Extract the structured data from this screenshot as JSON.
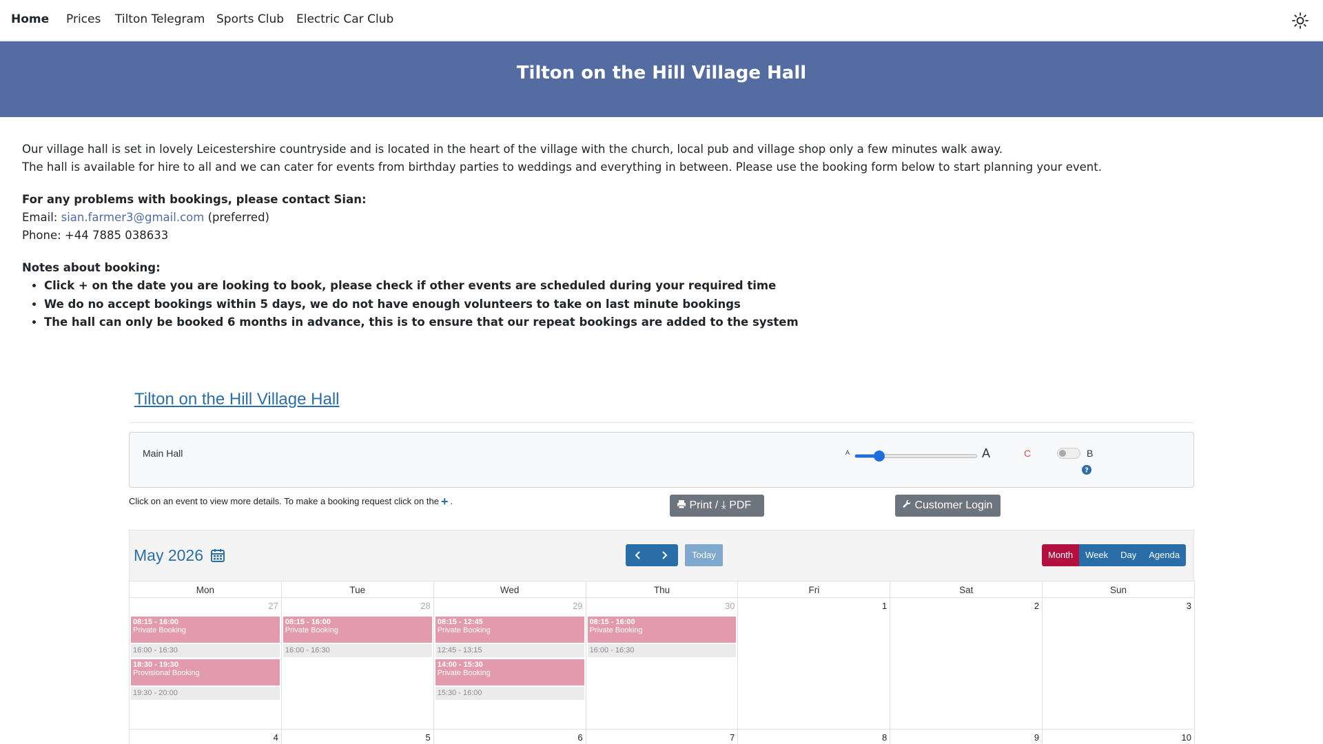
{
  "nav": {
    "items": [
      "Home",
      "Prices",
      "Tilton Telegram",
      "Sports Club",
      "Electric Car Club"
    ]
  },
  "banner": {
    "title": "Tilton on the Hill Village Hall"
  },
  "intro": {
    "p1": "Our village hall is set in lovely Leicestershire countryside and is located in the heart of the village with the church, local pub and village shop only a few minutes walk away.",
    "p2": "The hall is available for hire to all and we can cater for events from birthday parties to weddings and everything in between. Please use the booking form below to start planning your event.",
    "contact_heading": "For any problems with bookings, please contact Sian:",
    "email_label": "Email:",
    "email": "sian.farmer3@gmail.com",
    "email_suffix": "(preferred)",
    "phone": "Phone: +44 7885 038633",
    "notes_heading": "Notes about booking:",
    "notes": [
      "Click + on the date you are looking to book, please check if other events are scheduled during your required time",
      "We do no accept bookings within 5 days, we do not have enough volunteers to take on last minute bookings",
      "The hall can only be booked 6 months in advance, this is to ensure that our repeat bookings are added to the system"
    ]
  },
  "booking": {
    "title": "Tilton on the Hill Village Hall",
    "room": "Main Hall",
    "font_small": "A",
    "font_large": "A",
    "font_size_level": 0.2,
    "contrast_label": "C",
    "b_label": "B",
    "hint_before": "Click on an event to view more details. To make a booking request click on the",
    "hint_plus": "+",
    "hint_after": ".",
    "print_label": "Print / ⤓ PDF",
    "login_label": "Customer Login"
  },
  "calendar": {
    "title": "May 2026",
    "today_label": "Today",
    "views": [
      "Month",
      "Week",
      "Day",
      "Agenda"
    ],
    "active_view": "Month",
    "weekdays": [
      "Mon",
      "Tue",
      "Wed",
      "Thu",
      "Fri",
      "Sat",
      "Sun"
    ],
    "week1": [
      {
        "num": "27",
        "other": true,
        "items": [
          {
            "kind": "event",
            "time": "08:15 - 16:00",
            "label": "Private Booking"
          },
          {
            "kind": "gap",
            "time": "16:00 - 16:30"
          },
          {
            "kind": "event",
            "time": "18:30 - 19:30",
            "label": "Provisional Booking"
          },
          {
            "kind": "gap",
            "time": "19:30 - 20:00"
          }
        ]
      },
      {
        "num": "28",
        "other": true,
        "items": [
          {
            "kind": "event",
            "time": "08:15 - 16:00",
            "label": "Private Booking"
          },
          {
            "kind": "gap",
            "time": "16:00 - 16:30"
          }
        ]
      },
      {
        "num": "29",
        "other": true,
        "items": [
          {
            "kind": "event",
            "time": "08:15 - 12:45",
            "label": "Private Booking"
          },
          {
            "kind": "gap",
            "time": "12:45 - 13:15"
          },
          {
            "kind": "event",
            "time": "14:00 - 15:30",
            "label": "Private Booking"
          },
          {
            "kind": "gap",
            "time": "15:30 - 16:00"
          }
        ]
      },
      {
        "num": "30",
        "other": true,
        "items": [
          {
            "kind": "event",
            "time": "08:15 - 16:00",
            "label": "Private Booking"
          },
          {
            "kind": "gap",
            "time": "16:00 - 16:30"
          }
        ]
      },
      {
        "num": "1",
        "other": false,
        "items": []
      },
      {
        "num": "2",
        "other": false,
        "items": []
      },
      {
        "num": "3",
        "other": false,
        "items": []
      }
    ],
    "week2": [
      "4",
      "5",
      "6",
      "7",
      "8",
      "9",
      "10"
    ]
  }
}
